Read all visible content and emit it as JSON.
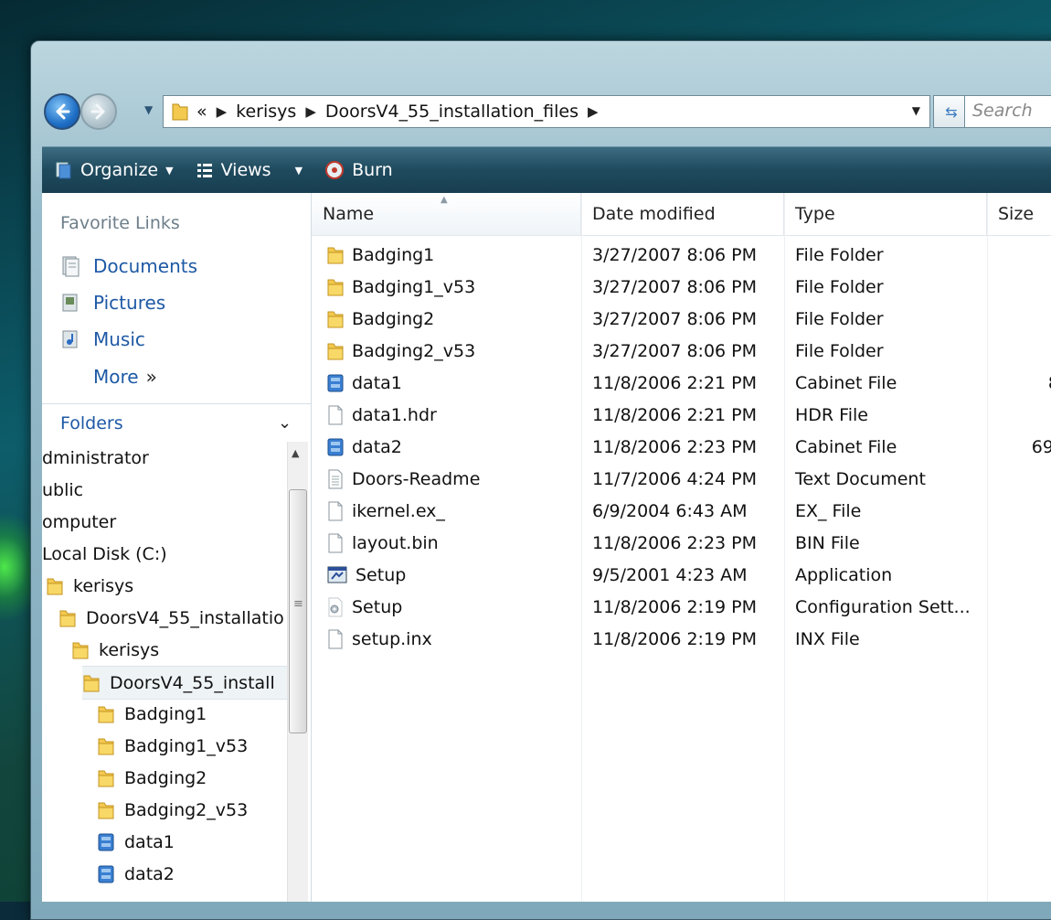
{
  "address": {
    "overflow": "«",
    "crumbs": [
      "kerisys",
      "DoorsV4_55_installation_files"
    ],
    "search_placeholder": "Search"
  },
  "toolbar": {
    "organize_label": "Organize",
    "views_label": "Views",
    "burn_label": "Burn"
  },
  "nav_pane": {
    "favorites_header": "Favorite Links",
    "favorites": [
      {
        "label": "Documents",
        "icon": "documents-icon"
      },
      {
        "label": "Pictures",
        "icon": "pictures-icon"
      },
      {
        "label": "Music",
        "icon": "music-icon"
      }
    ],
    "more_label": "More",
    "more_chevron": "»",
    "folders_header": "Folders",
    "tree": [
      {
        "label": "dministrator",
        "icon": "none",
        "level": 0
      },
      {
        "label": "ublic",
        "icon": "none",
        "level": 0
      },
      {
        "label": "omputer",
        "icon": "none",
        "level": 0
      },
      {
        "label": "Local Disk (C:)",
        "icon": "none",
        "level": 0
      },
      {
        "label": "kerisys",
        "icon": "folder-icon",
        "level": 1
      },
      {
        "label": "DoorsV4_55_installatio",
        "icon": "folder-icon",
        "level": 2
      },
      {
        "label": "kerisys",
        "icon": "folder-icon",
        "level": 3
      },
      {
        "label": "DoorsV4_55_install",
        "icon": "folder-icon",
        "level": 4,
        "selected": true
      },
      {
        "label": "Badging1",
        "icon": "folder-icon",
        "level": 5
      },
      {
        "label": "Badging1_v53",
        "icon": "folder-icon",
        "level": 5
      },
      {
        "label": "Badging2",
        "icon": "folder-icon",
        "level": 5
      },
      {
        "label": "Badging2_v53",
        "icon": "folder-icon",
        "level": 5
      },
      {
        "label": "data1",
        "icon": "cabinet-icon",
        "level": 5
      },
      {
        "label": "data2",
        "icon": "cabinet-icon",
        "level": 5
      }
    ]
  },
  "file_list": {
    "columns": {
      "name": "Name",
      "date": "Date modified",
      "type": "Type",
      "size": "Size"
    },
    "rows": [
      {
        "name": "Badging1",
        "date": "3/27/2007 8:06 PM",
        "type": "File Folder",
        "size": "",
        "icon": "folder-icon"
      },
      {
        "name": "Badging1_v53",
        "date": "3/27/2007 8:06 PM",
        "type": "File Folder",
        "size": "",
        "icon": "folder-icon"
      },
      {
        "name": "Badging2",
        "date": "3/27/2007 8:06 PM",
        "type": "File Folder",
        "size": "",
        "icon": "folder-icon"
      },
      {
        "name": "Badging2_v53",
        "date": "3/27/2007 8:06 PM",
        "type": "File Folder",
        "size": "",
        "icon": "folder-icon"
      },
      {
        "name": "data1",
        "date": "11/8/2006 2:21 PM",
        "type": "Cabinet File",
        "size": "8",
        "icon": "cabinet-icon"
      },
      {
        "name": "data1.hdr",
        "date": "11/8/2006 2:21 PM",
        "type": "HDR File",
        "size": "",
        "icon": "file-icon"
      },
      {
        "name": "data2",
        "date": "11/8/2006 2:23 PM",
        "type": "Cabinet File",
        "size": "69,",
        "icon": "cabinet-icon"
      },
      {
        "name": "Doors-Readme",
        "date": "11/7/2006 4:24 PM",
        "type": "Text Document",
        "size": "",
        "icon": "text-file-icon"
      },
      {
        "name": "ikernel.ex_",
        "date": "6/9/2004 6:43 AM",
        "type": "EX_ File",
        "size": "",
        "icon": "file-icon"
      },
      {
        "name": "layout.bin",
        "date": "11/8/2006 2:23 PM",
        "type": "BIN File",
        "size": "",
        "icon": "file-icon"
      },
      {
        "name": "Setup",
        "date": "9/5/2001 4:23 AM",
        "type": "Application",
        "size": "",
        "icon": "application-icon"
      },
      {
        "name": "Setup",
        "date": "11/8/2006 2:19 PM",
        "type": "Configuration Sett...",
        "size": "",
        "icon": "config-file-icon"
      },
      {
        "name": "setup.inx",
        "date": "11/8/2006 2:19 PM",
        "type": "INX File",
        "size": "",
        "icon": "file-icon"
      }
    ]
  }
}
